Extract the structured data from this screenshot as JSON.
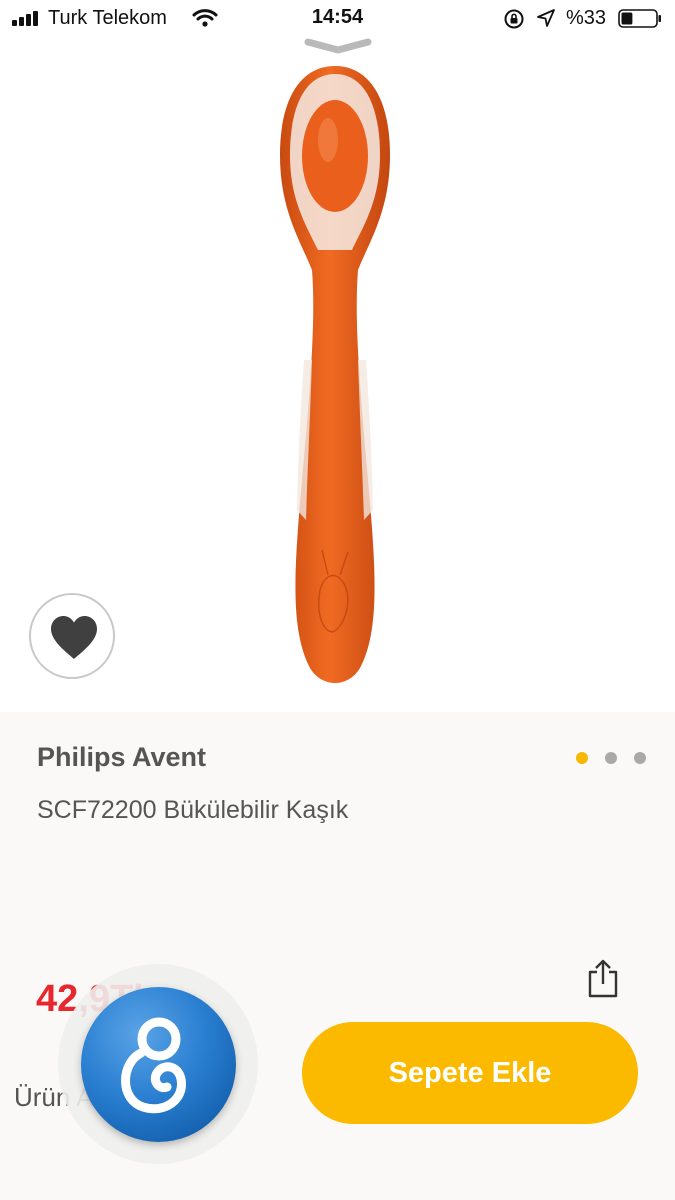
{
  "status_bar": {
    "carrier": "Turk Telekom",
    "time": "14:54",
    "battery": "%33",
    "battery_level": 0.33,
    "icons": [
      "signal-icon",
      "wifi-icon",
      "rotation-lock-icon",
      "location-icon",
      "battery-icon"
    ]
  },
  "product": {
    "brand": "Philips Avent",
    "name": "SCF72200 Bükülebilir Kaşık",
    "price_visible": "42,9",
    "price_partial_suffix": "Tl",
    "sub_label": "Ürün A",
    "image_count": 3,
    "active_image_index": 0
  },
  "actions": {
    "add_to_cart": "Sepete Ekle",
    "favorite_icon": "heart-icon",
    "share_icon": "share-icon",
    "logo_icon": "app-logo-icon"
  },
  "colors": {
    "accent": "#fbb900",
    "price": "#e8262d",
    "active_dot": "#f8b800",
    "inactive_dot": "#a9a9a9",
    "spoon": "#e8601c",
    "logo_blue": "#2a7fd1",
    "panel_background": "#faf9f7"
  }
}
